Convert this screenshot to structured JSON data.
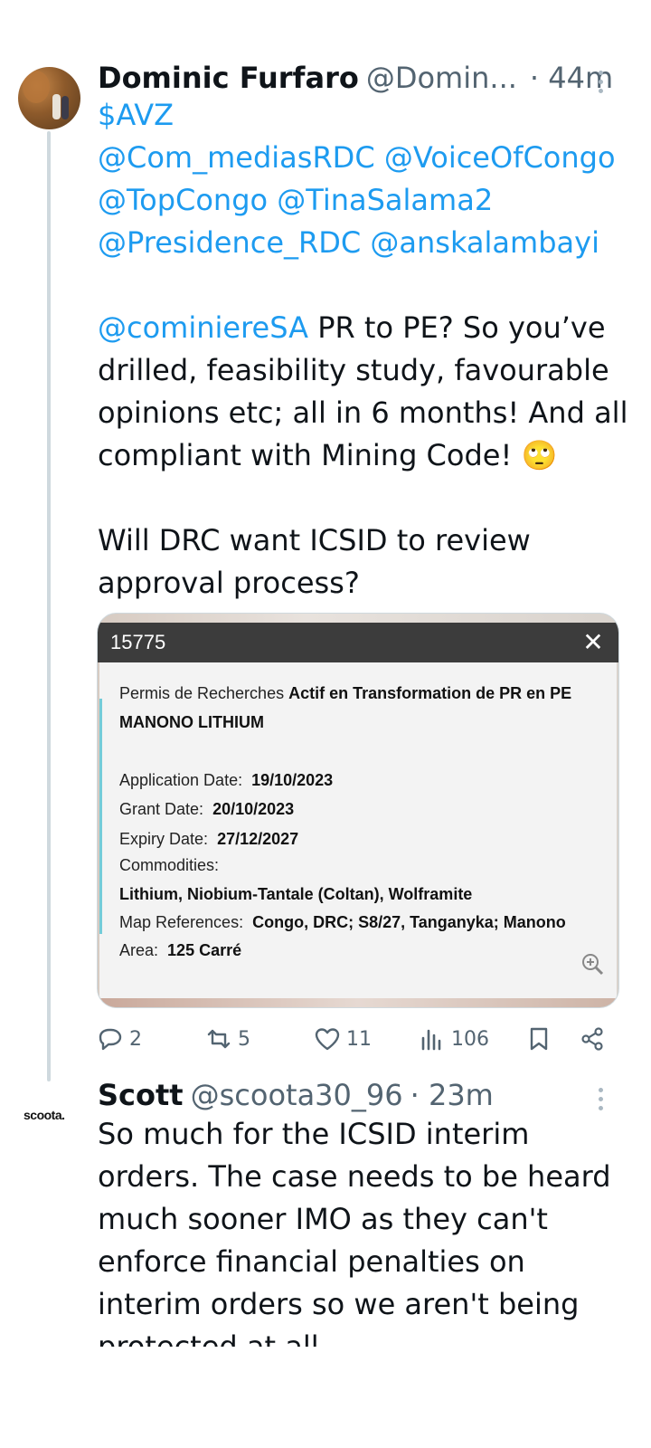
{
  "tweet1": {
    "author_name": "Dominic Furfaro",
    "handle": "@Domin...",
    "time": "· 44m",
    "mentions_line1": "$AVZ",
    "mentions_line2": "@Com_mediasRDC @VoiceOfCongo",
    "mentions_line3": "@TopCongo @TinaSalama2",
    "mentions_line4": "@Presidence_RDC @anskalambayi",
    "reply_mention": "@cominiereSA",
    "body_text": " PR to PE? So you’ve drilled, feasibility study, favourable opinions etc; all in 6 months! And all compliant with Mining Code! 🙄\n\nWill DRC want ICSID to review approval process?",
    "card": {
      "id": "15775",
      "close": "✕",
      "permit_label": "Permis de Recherches",
      "permit_status": "Actif en Transformation de PR en PE",
      "permit_name": "MANONO LITHIUM",
      "application_label": "Application Date:",
      "application_value": "19/10/2023",
      "grant_label": "Grant Date:",
      "grant_value": "20/10/2023",
      "expiry_label": "Expiry Date:",
      "expiry_value": "27/12/2027",
      "commodities_label": "Commodities:",
      "commodities_value": "Lithium, Niobium-Tantale (Coltan), Wolframite",
      "mapref_label": "Map References:",
      "mapref_value": "Congo, DRC; S8/27, Tanganyka; Manono",
      "area_label": "Area:",
      "area_value": "125 Carré"
    },
    "actions": {
      "replies": "2",
      "retweets": "5",
      "likes": "11",
      "views": "106"
    }
  },
  "tweet2": {
    "avatar_text": "scoota.",
    "author_name": "Scott",
    "handle": "@scoota30_96",
    "time": "· 23m",
    "body_text": "So much for the ICSID interim orders. The case needs to be heard much sooner IMO as they can't enforce financial penalties on interim orders so we aren't being protected at all."
  },
  "icons": [
    "more-icon",
    "reply-icon",
    "retweet-icon",
    "like-icon",
    "views-icon",
    "bookmark-icon",
    "share-icon",
    "zoom-icon",
    "close-icon"
  ]
}
